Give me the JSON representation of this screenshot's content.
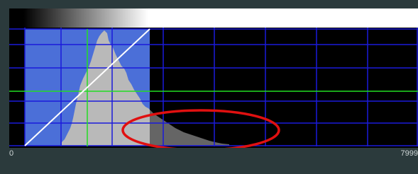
{
  "histogram": {
    "axis_min_label": "0",
    "axis_max_label": "7999",
    "colors": {
      "background": "#000000",
      "selection_fill": "#4b6fd8",
      "grid": "#1a1adb",
      "histogram_fill": "#b9b9b9",
      "marker_line": "#22dd22",
      "curve": "#ffffff",
      "highlight_ellipse": "#e01010"
    }
  }
}
